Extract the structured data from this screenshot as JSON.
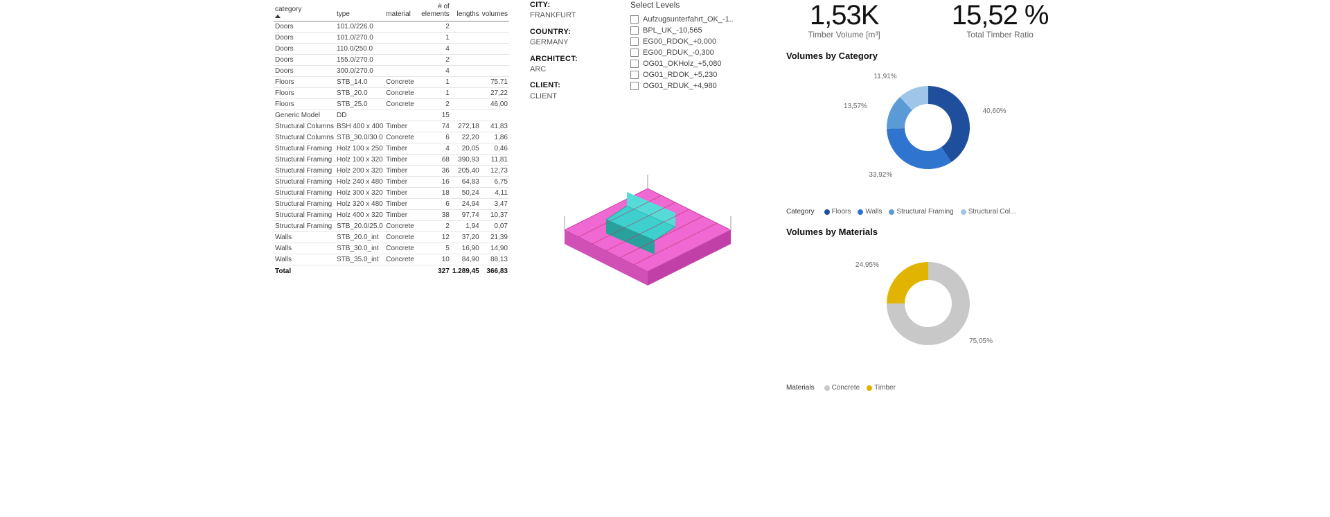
{
  "table": {
    "headers": [
      "category",
      "type",
      "material",
      "# of elements",
      "lengths",
      "volumes"
    ],
    "rows": [
      {
        "category": "Doors",
        "type": "101.0/226.0",
        "material": "",
        "elements": "2",
        "lengths": "",
        "volumes": ""
      },
      {
        "category": "Doors",
        "type": "101.0/270.0",
        "material": "",
        "elements": "1",
        "lengths": "",
        "volumes": ""
      },
      {
        "category": "Doors",
        "type": "110.0/250.0",
        "material": "",
        "elements": "4",
        "lengths": "",
        "volumes": ""
      },
      {
        "category": "Doors",
        "type": "155.0/270.0",
        "material": "",
        "elements": "2",
        "lengths": "",
        "volumes": ""
      },
      {
        "category": "Doors",
        "type": "300.0/270.0",
        "material": "",
        "elements": "4",
        "lengths": "",
        "volumes": ""
      },
      {
        "category": "Floors",
        "type": "STB_14.0",
        "material": "Concrete",
        "elements": "1",
        "lengths": "",
        "volumes": "75,71"
      },
      {
        "category": "Floors",
        "type": "STB_20.0",
        "material": "Concrete",
        "elements": "1",
        "lengths": "",
        "volumes": "27,22"
      },
      {
        "category": "Floors",
        "type": "STB_25.0",
        "material": "Concrete",
        "elements": "2",
        "lengths": "",
        "volumes": "46,00"
      },
      {
        "category": "Generic Model",
        "type": "DD",
        "material": "",
        "elements": "15",
        "lengths": "",
        "volumes": ""
      },
      {
        "category": "Structural Columns",
        "type": "BSH 400 x 400",
        "material": "Timber",
        "elements": "74",
        "lengths": "272,18",
        "volumes": "41,83"
      },
      {
        "category": "Structural Columns",
        "type": "STB_30.0/30.0",
        "material": "Concrete",
        "elements": "6",
        "lengths": "22,20",
        "volumes": "1,86"
      },
      {
        "category": "Structural Framing",
        "type": "Holz 100 x 250",
        "material": "Timber",
        "elements": "4",
        "lengths": "20,05",
        "volumes": "0,46"
      },
      {
        "category": "Structural Framing",
        "type": "Holz 100 x 320",
        "material": "Timber",
        "elements": "68",
        "lengths": "390,93",
        "volumes": "11,81"
      },
      {
        "category": "Structural Framing",
        "type": "Holz 200 x 320",
        "material": "Timber",
        "elements": "36",
        "lengths": "205,40",
        "volumes": "12,73"
      },
      {
        "category": "Structural Framing",
        "type": "Holz 240 x 480",
        "material": "Timber",
        "elements": "16",
        "lengths": "64,83",
        "volumes": "6,75"
      },
      {
        "category": "Structural Framing",
        "type": "Holz 300 x 320",
        "material": "Timber",
        "elements": "18",
        "lengths": "50,24",
        "volumes": "4,11"
      },
      {
        "category": "Structural Framing",
        "type": "Holz 320 x 480",
        "material": "Timber",
        "elements": "6",
        "lengths": "24,94",
        "volumes": "3,47"
      },
      {
        "category": "Structural Framing",
        "type": "Holz 400 x 320",
        "material": "Timber",
        "elements": "38",
        "lengths": "97,74",
        "volumes": "10,37"
      },
      {
        "category": "Structural Framing",
        "type": "STB_20.0/25.0",
        "material": "Concrete",
        "elements": "2",
        "lengths": "1,94",
        "volumes": "0,07"
      },
      {
        "category": "Walls",
        "type": "STB_20.0_int",
        "material": "Concrete",
        "elements": "12",
        "lengths": "37,20",
        "volumes": "21,39"
      },
      {
        "category": "Walls",
        "type": "STB_30.0_int",
        "material": "Concrete",
        "elements": "5",
        "lengths": "16,90",
        "volumes": "14,90"
      },
      {
        "category": "Walls",
        "type": "STB_35.0_int",
        "material": "Concrete",
        "elements": "10",
        "lengths": "84,90",
        "volumes": "88,13"
      }
    ],
    "total": {
      "label": "Total",
      "elements": "327",
      "lengths": "1.289,45",
      "volumes": "366,83"
    }
  },
  "project": {
    "city_label": "CITY:",
    "city": "FRANKFURT",
    "country_label": "COUNTRY:",
    "country": "GERMANY",
    "architect_label": "ARCHITECT:",
    "architect": "ARC",
    "client_label": "CLIENT:",
    "client": "CLIENT"
  },
  "levels": {
    "title": "Select Levels",
    "items": [
      "Aufzugsunterfahrt_OK_-1..",
      "BPL_UK_-10,565",
      "EG00_RDOK_+0,000",
      "EG00_RDUK_-0,300",
      "OG01_OKHolz_+5,080",
      "OG01_RDOK_+5,230",
      "OG01_RDUK_+4,980"
    ]
  },
  "kpi": {
    "timber_volume": "1,53K",
    "timber_volume_label": "Timber Volume [m³]",
    "timber_ratio": "15,52 %",
    "timber_ratio_label": "Total Timber Ratio"
  },
  "chart_data": [
    {
      "type": "pie",
      "title": "Volumes by Category",
      "series": [
        {
          "name": "Floors",
          "value": 40.6,
          "color": "#1f4e9c"
        },
        {
          "name": "Walls",
          "value": 33.92,
          "color": "#2f74cf"
        },
        {
          "name": "Structural Framing",
          "value": 13.57,
          "color": "#5b9bd5"
        },
        {
          "name": "Structural Col...",
          "value": 11.91,
          "color": "#9fc5e8"
        }
      ],
      "legend_label": "Category"
    },
    {
      "type": "pie",
      "title": "Volumes by Materials",
      "series": [
        {
          "name": "Concrete",
          "value": 75.05,
          "color": "#c8c8c8"
        },
        {
          "name": "Timber",
          "value": 24.95,
          "color": "#e0b400"
        }
      ],
      "legend_label": "Materials"
    }
  ]
}
